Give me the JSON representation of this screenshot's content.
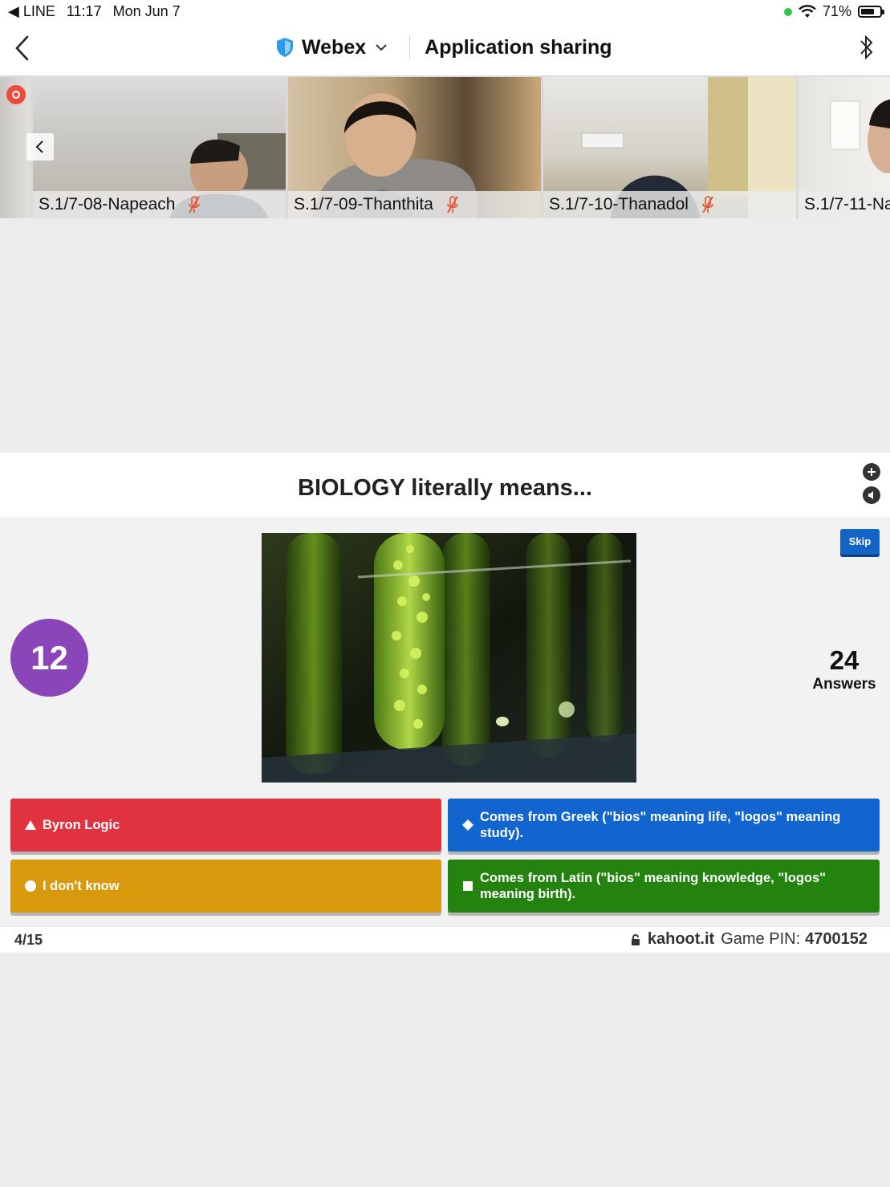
{
  "status_bar": {
    "back_app": "◀ LINE",
    "time": "11:17",
    "date": "Mon Jun 7",
    "battery": "71%",
    "battery_level": 0.71
  },
  "nav": {
    "app_name": "Webex",
    "title": "Application sharing"
  },
  "participants": [
    {
      "name": "S.1/7-08-Napeach"
    },
    {
      "name": "S.1/7-09-Thanthita"
    },
    {
      "name": "S.1/7-10-Thanadol"
    },
    {
      "name": "S.1/7-11-Na"
    }
  ],
  "kahoot": {
    "question": "BIOLOGY literally means...",
    "timer": "12",
    "skip_label": "Skip",
    "answers_count": "24",
    "answers_label": "Answers",
    "options": [
      {
        "text": "Byron Logic",
        "shape": "triangle",
        "color": "#e0323f"
      },
      {
        "text": "Comes from Greek (\"bios\" meaning life, \"logos\" meaning study).",
        "shape": "diamond",
        "color": "#1264cf"
      },
      {
        "text": "I don't know",
        "shape": "circle",
        "color": "#d89a0c"
      },
      {
        "text": "Comes from Latin (\"bios\" meaning knowledge, \"logos\" meaning birth).",
        "shape": "square",
        "color": "#24820f"
      }
    ],
    "progress": "4/15",
    "site": "kahoot.it",
    "pin_label": "Game PIN:",
    "pin_value": "4700152"
  }
}
